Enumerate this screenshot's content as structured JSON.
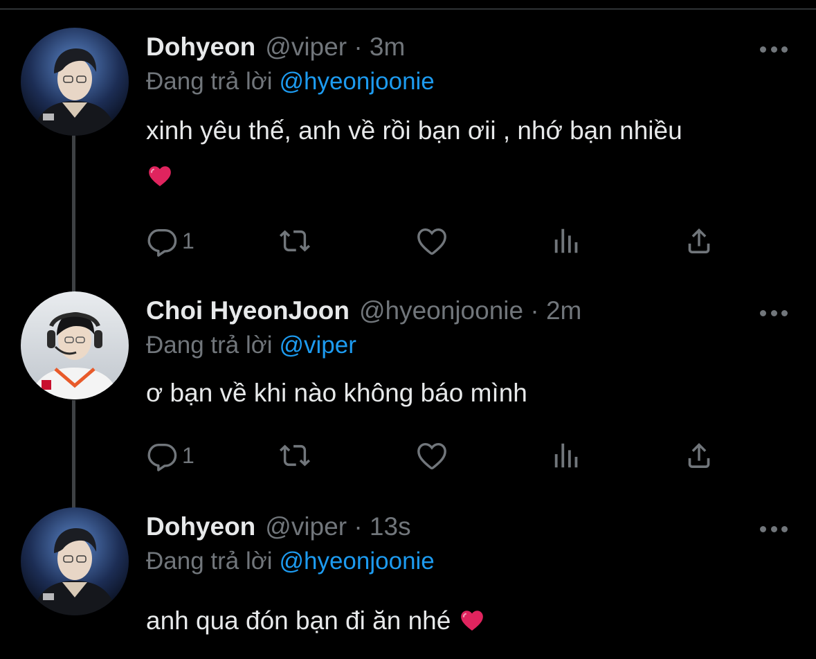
{
  "colors": {
    "background": "#000000",
    "text": "#e7e9ea",
    "secondary": "#71767b",
    "mention": "#1d9bf0",
    "heart": "#e0245e"
  },
  "reply_prefix": "Đang trả lời",
  "tweets": [
    {
      "display_name": "Dohyeon",
      "handle_time": "@viper · 3m",
      "reply_to": "@hyeonjoonie",
      "text": "xinh yêu thế, anh về rồi bạn ơii , nhớ bạn nhiều",
      "emoji": "red-heart",
      "reply_count": "1",
      "avatar": "profile-photo-dohyeon"
    },
    {
      "display_name": "Choi HyeonJoon",
      "handle_time": "@hyeonjoonie · 2m",
      "reply_to": "@viper",
      "text": "ơ bạn về khi nào không báo mình",
      "reply_count": "1",
      "avatar": "profile-photo-hyeonjoon"
    },
    {
      "display_name": "Dohyeon",
      "handle_time": "@viper · 13s",
      "reply_to": "@hyeonjoonie",
      "text": "anh qua đón bạn đi ăn nhé",
      "emoji": "red-heart",
      "avatar": "profile-photo-dohyeon"
    }
  ],
  "icons": {
    "reply": "reply-icon",
    "retweet": "retweet-icon",
    "like": "like-icon",
    "views": "views-icon",
    "share": "share-icon",
    "more": "more-icon"
  }
}
